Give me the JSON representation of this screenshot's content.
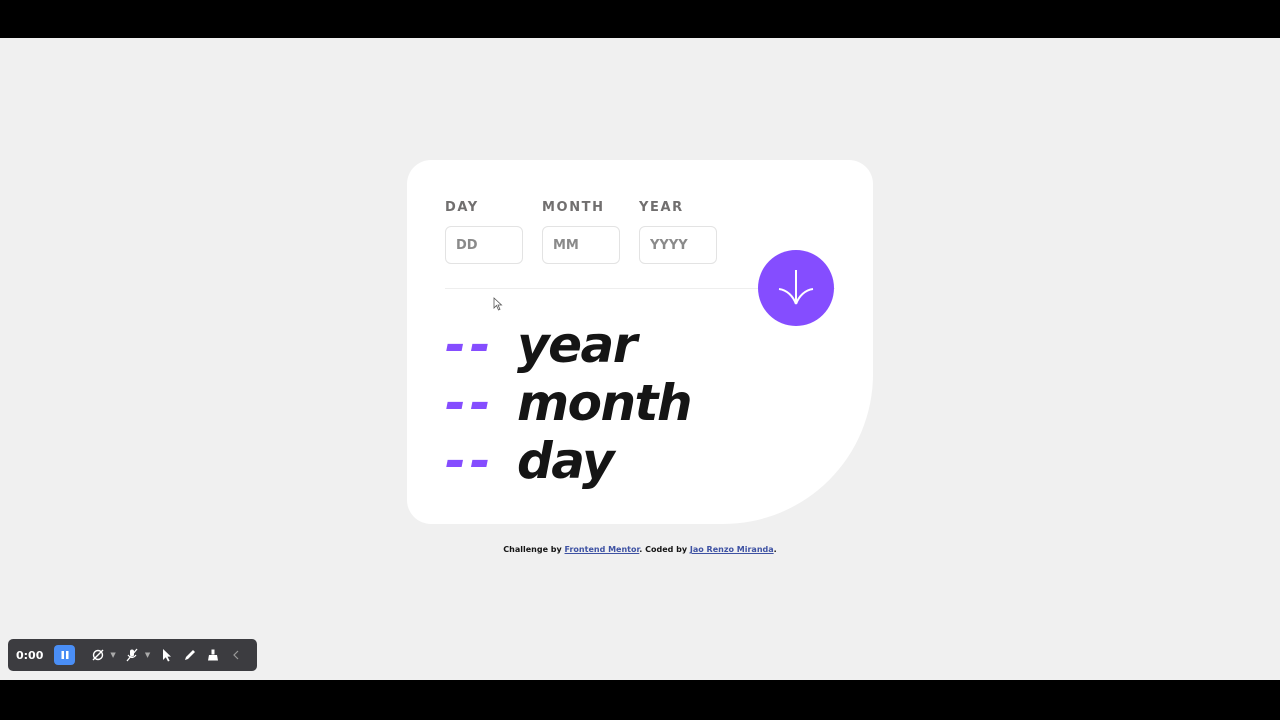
{
  "form": {
    "day": {
      "label": "DAY",
      "placeholder": "DD"
    },
    "month": {
      "label": "MONTH",
      "placeholder": "MM"
    },
    "year": {
      "label": "YEAR",
      "placeholder": "YYYY"
    }
  },
  "submit": {
    "icon": "arrow-down-icon"
  },
  "results": {
    "years": {
      "value": "--",
      "unit": "year"
    },
    "months": {
      "value": "--",
      "unit": "month"
    },
    "days": {
      "value": "--",
      "unit": "day"
    }
  },
  "attribution": {
    "prefix": "Challenge by ",
    "link1": "Frontend Mentor",
    "middle": ". Coded by ",
    "link2": "Jao Renzo Miranda",
    "suffix": "."
  },
  "recorder": {
    "time": "0:00",
    "icons": [
      "pause-icon",
      "camera-off-icon",
      "mic-off-icon",
      "pointer-icon",
      "pen-icon",
      "eraser-icon",
      "collapse-icon"
    ]
  },
  "colors": {
    "accent": "#854dff",
    "text": "#151515",
    "label": "#716f6f",
    "background": "#f0f0f0",
    "card": "#ffffff"
  }
}
